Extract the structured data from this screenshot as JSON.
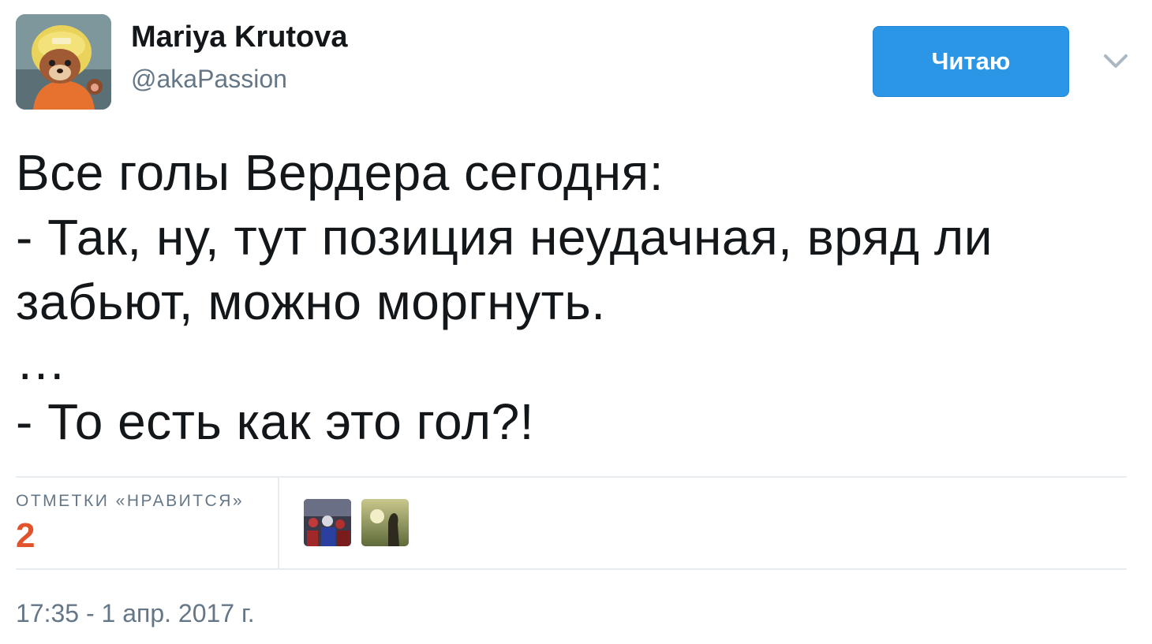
{
  "author": {
    "name": "Mariya Krutova",
    "handle": "@akaPassion",
    "avatar_icon": "fox-astronaut-avatar-icon"
  },
  "follow_button": {
    "label": "Читаю",
    "color": "#2b96e6"
  },
  "menu_icon": "chevron-down-icon",
  "tweet": {
    "lines": [
      "Все голы Вердера сегодня:",
      "- Так, ну, тут позиция неудачная, вряд ли",
      "забьют, можно моргнуть.",
      "…",
      "- То есть как это гол?!"
    ]
  },
  "stats": {
    "likes_label": "ОТМЕТКИ «НРАВИТСЯ»",
    "likes_count": "2",
    "count_color": "#e0532c",
    "liker_avatars": [
      "stadium-crowd-avatar-icon",
      "sunset-silhouette-avatar-icon"
    ]
  },
  "timestamp": "17:35 - 1 апр. 2017 г."
}
